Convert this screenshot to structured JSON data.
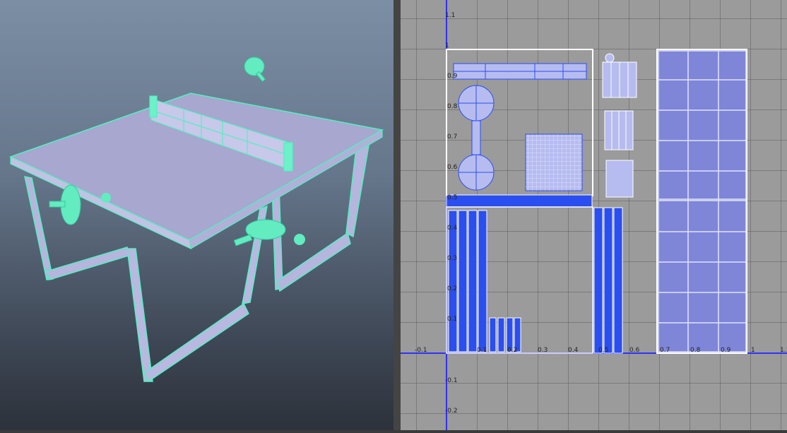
{
  "viewport": {
    "object": "ping-pong-table",
    "colors": {
      "background_top": "#7c8ea4",
      "background_bottom": "#2d323b",
      "mesh": "#b7b7dc",
      "wire": "#52f0c0"
    }
  },
  "uv_editor": {
    "ticks_x": [
      "-0.1",
      "0.1",
      "0.2",
      "0.3",
      "0.4",
      "0.5",
      "0.6",
      "0.7",
      "0.8",
      "0.9",
      "1",
      "1.1"
    ],
    "ticks_y": [
      "1.1",
      "1",
      "0.9",
      "0.8",
      "0.7",
      "0.6",
      "0.5",
      "0.4",
      "0.3",
      "0.2",
      "0.1",
      "-0.1",
      "-0.2"
    ],
    "colors": {
      "background": "#9b9b9b",
      "grid": "#555555",
      "axis": "#3030ff",
      "uv_fill": "#2a4ef0",
      "uv_border": "#ffffff"
    }
  }
}
